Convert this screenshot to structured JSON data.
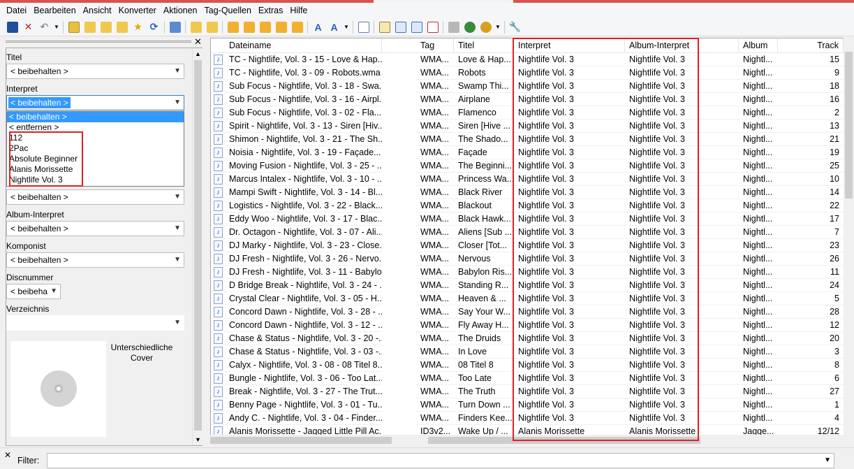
{
  "menu": [
    "Datei",
    "Bearbeiten",
    "Ansicht",
    "Konverter",
    "Aktionen",
    "Tag-Quellen",
    "Extras",
    "Hilfe"
  ],
  "toolbar_icons": [
    "save-icon",
    "delete-icon",
    "undo-icon",
    "undo-dropdown-icon",
    "add-icon",
    "folder-open-icon",
    "folder-tree-icon",
    "folder-go-icon",
    "favorite-icon",
    "refresh-icon",
    "list-icon",
    "tag-to-filename-icon",
    "filename-to-tag-icon",
    "convert-1-icon",
    "convert-2-icon",
    "convert-3-icon",
    "convert-4-icon",
    "convert-5-icon",
    "text-icon",
    "text-format-icon",
    "text-format-dropdown-icon",
    "edit-icon",
    "export-icon",
    "playlist-icon",
    "playlist-2-icon",
    "tag-source-icon",
    "print-icon",
    "web-icon",
    "web-dropdown-icon",
    "settings-icon"
  ],
  "panel": {
    "titel_label": "Titel",
    "titel_value": "< beibehalten >",
    "interpret_label": "Interpret",
    "interpret_value": "< beibehalten >",
    "interpret_options": [
      "< beibehalten >",
      "< entfernen >",
      "112",
      "2Pac",
      "Absolute Beginner",
      "Alanis Morissette",
      "Nightlife Vol. 3"
    ],
    "hidden_combo_value": "< beibehalten >",
    "album_interpret_label": "Album-Interpret",
    "album_interpret_value": "< beibehalten >",
    "komponist_label": "Komponist",
    "komponist_value": "< beibehalten >",
    "discnummer_label": "Discnummer",
    "discnummer_value": "< beibeha",
    "verzeichnis_label": "Verzeichnis",
    "verzeichnis_value": "",
    "cover_text": "Unterschiedliche Cover"
  },
  "table": {
    "headers": [
      "Dateiname",
      "Tag",
      "Titel",
      "Interpret",
      "Album-Interpret",
      "Album",
      "Track"
    ],
    "rows": [
      [
        "TC - Nightlife, Vol. 3 - 15 - Love & Hap...",
        "WMA...",
        "Love & Hap...",
        "Nightlife Vol. 3",
        "Nightlife Vol. 3",
        "Nightl...",
        "15"
      ],
      [
        "TC - Nightlife, Vol. 3 - 09 - Robots.wma",
        "WMA...",
        "Robots",
        "Nightlife Vol. 3",
        "Nightlife Vol. 3",
        "Nightl...",
        "9"
      ],
      [
        "Sub Focus - Nightlife, Vol. 3 - 18 - Swa...",
        "WMA...",
        "Swamp Thi...",
        "Nightlife Vol. 3",
        "Nightlife Vol. 3",
        "Nightl...",
        "18"
      ],
      [
        "Sub Focus - Nightlife, Vol. 3 - 16 - Airpl...",
        "WMA...",
        "Airplane",
        "Nightlife Vol. 3",
        "Nightlife Vol. 3",
        "Nightl...",
        "16"
      ],
      [
        "Sub Focus - Nightlife, Vol. 3 - 02 - Fla...",
        "WMA...",
        "Flamenco",
        "Nightlife Vol. 3",
        "Nightlife Vol. 3",
        "Nightl...",
        "2"
      ],
      [
        "Spirit - Nightlife, Vol. 3 - 13 - Siren [Hiv...",
        "WMA...",
        "Siren [Hive ...",
        "Nightlife Vol. 3",
        "Nightlife Vol. 3",
        "Nightl...",
        "13"
      ],
      [
        "Shimon - Nightlife, Vol. 3 - 21 - The Sh...",
        "WMA...",
        "The Shado...",
        "Nightlife Vol. 3",
        "Nightlife Vol. 3",
        "Nightl...",
        "21"
      ],
      [
        "Noisia - Nightlife, Vol. 3 - 19 - Façade...",
        "WMA...",
        "Façade",
        "Nightlife Vol. 3",
        "Nightlife Vol. 3",
        "Nightl...",
        "19"
      ],
      [
        "Moving Fusion - Nightlife, Vol. 3 - 25 - ...",
        "WMA...",
        "The Beginni...",
        "Nightlife Vol. 3",
        "Nightlife Vol. 3",
        "Nightl...",
        "25"
      ],
      [
        "Marcus Intalex - Nightlife, Vol. 3 - 10 - ...",
        "WMA...",
        "Princess Wa...",
        "Nightlife Vol. 3",
        "Nightlife Vol. 3",
        "Nightl...",
        "10"
      ],
      [
        "Mampi Swift - Nightlife, Vol. 3 - 14 - Bl...",
        "WMA...",
        "Black River",
        "Nightlife Vol. 3",
        "Nightlife Vol. 3",
        "Nightl...",
        "14"
      ],
      [
        "Logistics - Nightlife, Vol. 3 - 22 - Black...",
        "WMA...",
        "Blackout",
        "Nightlife Vol. 3",
        "Nightlife Vol. 3",
        "Nightl...",
        "22"
      ],
      [
        "Eddy Woo - Nightlife, Vol. 3 - 17 - Blac...",
        "WMA...",
        "Black Hawk...",
        "Nightlife Vol. 3",
        "Nightlife Vol. 3",
        "Nightl...",
        "17"
      ],
      [
        "Dr. Octagon - Nightlife, Vol. 3 - 07 - Ali...",
        "WMA...",
        "Aliens [Sub ...",
        "Nightlife Vol. 3",
        "Nightlife Vol. 3",
        "Nightl...",
        "7"
      ],
      [
        "DJ Marky - Nightlife, Vol. 3 - 23 - Close...",
        "WMA...",
        "Closer [Tot...",
        "Nightlife Vol. 3",
        "Nightlife Vol. 3",
        "Nightl...",
        "23"
      ],
      [
        "DJ Fresh - Nightlife, Vol. 3 - 26 - Nervo...",
        "WMA...",
        "Nervous",
        "Nightlife Vol. 3",
        "Nightlife Vol. 3",
        "Nightl...",
        "26"
      ],
      [
        "DJ Fresh - Nightlife, Vol. 3 - 11 - Babylo...",
        "WMA...",
        "Babylon Ris...",
        "Nightlife Vol. 3",
        "Nightlife Vol. 3",
        "Nightl...",
        "11"
      ],
      [
        "D Bridge Break - Nightlife, Vol. 3 - 24 - ...",
        "WMA...",
        "Standing R...",
        "Nightlife Vol. 3",
        "Nightlife Vol. 3",
        "Nightl...",
        "24"
      ],
      [
        "Crystal Clear - Nightlife, Vol. 3 - 05 - H...",
        "WMA...",
        "Heaven & ...",
        "Nightlife Vol. 3",
        "Nightlife Vol. 3",
        "Nightl...",
        "5"
      ],
      [
        "Concord Dawn - Nightlife, Vol. 3 - 28 - ...",
        "WMA...",
        "Say Your W...",
        "Nightlife Vol. 3",
        "Nightlife Vol. 3",
        "Nightl...",
        "28"
      ],
      [
        "Concord Dawn - Nightlife, Vol. 3 - 12 - ...",
        "WMA...",
        "Fly Away H...",
        "Nightlife Vol. 3",
        "Nightlife Vol. 3",
        "Nightl...",
        "12"
      ],
      [
        "Chase & Status - Nightlife, Vol. 3 - 20 -...",
        "WMA...",
        "The Druids",
        "Nightlife Vol. 3",
        "Nightlife Vol. 3",
        "Nightl...",
        "20"
      ],
      [
        "Chase & Status - Nightlife, Vol. 3 - 03 -...",
        "WMA...",
        "In Love",
        "Nightlife Vol. 3",
        "Nightlife Vol. 3",
        "Nightl...",
        "3"
      ],
      [
        "Calyx - Nightlife, Vol. 3 - 08 - 08 Titel 8....",
        "WMA...",
        "08 Titel 8",
        "Nightlife Vol. 3",
        "Nightlife Vol. 3",
        "Nightl...",
        "8"
      ],
      [
        "Bungle - Nightlife, Vol. 3 - 06 - Too Lat...",
        "WMA...",
        "Too Late",
        "Nightlife Vol. 3",
        "Nightlife Vol. 3",
        "Nightl...",
        "6"
      ],
      [
        "Break - Nightlife, Vol. 3 - 27 - The Trut...",
        "WMA...",
        "The Truth",
        "Nightlife Vol. 3",
        "Nightlife Vol. 3",
        "Nightl...",
        "27"
      ],
      [
        "Benny Page - Nightlife, Vol. 3 - 01 - Tu...",
        "WMA...",
        "Turn Down ...",
        "Nightlife Vol. 3",
        "Nightlife Vol. 3",
        "Nightl...",
        "1"
      ],
      [
        "Andy C. - Nightlife, Vol. 3 - 04 - Finder...",
        "WMA...",
        "Finders Kee...",
        "Nightlife Vol. 3",
        "Nightlife Vol. 3",
        "Nightl...",
        "4"
      ],
      [
        "Alanis Morissette - Jagged Little Pill Ac...",
        "ID3v2...",
        "Wake Up / ...",
        "Alanis Morissette",
        "Alanis Morissette",
        "Jagge...",
        "12/12"
      ]
    ]
  },
  "filter": {
    "label": "Filter:",
    "value": ""
  },
  "colors": {
    "highlight": "#e31e24",
    "selection": "#3399ff"
  }
}
